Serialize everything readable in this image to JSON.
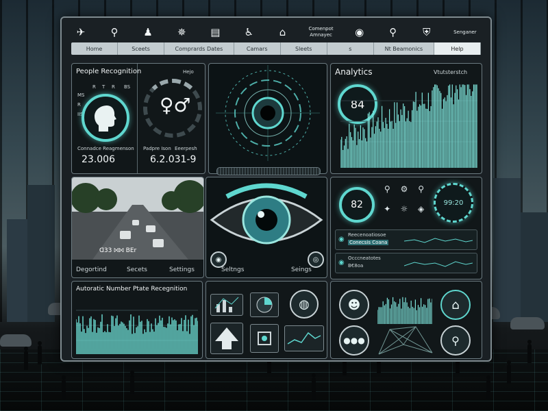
{
  "toolbar": {
    "icons": [
      {
        "name": "drone-icon",
        "glyph": "✈"
      },
      {
        "name": "location-pin-icon",
        "glyph": "⚲"
      },
      {
        "name": "person-icon",
        "glyph": "♟"
      },
      {
        "name": "network-icon",
        "glyph": "✵"
      },
      {
        "name": "server-icon",
        "glyph": "▤"
      },
      {
        "name": "accessibility-icon",
        "glyph": "♿"
      },
      {
        "name": "home-icon",
        "glyph": "⌂"
      }
    ],
    "component_text": "Comenpot Amnayec",
    "right_icons": [
      {
        "name": "aperture-icon",
        "glyph": "◉"
      },
      {
        "name": "badge-icon",
        "glyph": "⚲"
      },
      {
        "name": "shield-icon",
        "glyph": "⛨"
      }
    ],
    "brand": "Senganer"
  },
  "nav": {
    "items": [
      "Home",
      "Sceets",
      "Comprards Dates",
      "Camars",
      "Sleets",
      "s",
      "Nt Beamonics",
      "Help"
    ],
    "active_index": 7
  },
  "people_panel": {
    "title": "People Recognition",
    "help": "Hejo",
    "tiny_labels": [
      "MS",
      "R",
      "T",
      "R",
      "BS",
      "R",
      "IIS"
    ],
    "left_caption": "Connadce Reagmenson",
    "left_value": "23.006",
    "right_caption_a": "Padpre Ison",
    "right_caption_b": "Eeerpesh",
    "right_value": "6.2.031-9"
  },
  "analytics_panel": {
    "title": "Analytics",
    "subtitle": "Vtutsterstch",
    "gauge_value": "84"
  },
  "street_panel": {
    "overlay_text": "ꓷ33   ⨝⨝   BEr",
    "label_left": "Degortind",
    "label_mid": "Secets",
    "label_right": "Settings"
  },
  "eye_panel": {
    "label_left": "Seltngs",
    "label_right": "Seings"
  },
  "stats_panel": {
    "gauge_value": "82",
    "clock_value": "99:20",
    "row1_line1": "Reecenoatiosoe",
    "row1_line2": "Conecsis Coana",
    "row2_line1": "Occcneatotes",
    "row2_line2": "B€8oa"
  },
  "anpr_panel": {
    "title": "Autoratic Number Ptate Recegnition"
  },
  "colors": {
    "accent": "#5fd7cf",
    "panel_bg": "#111719",
    "nav_bg": "#c3ccd0"
  }
}
